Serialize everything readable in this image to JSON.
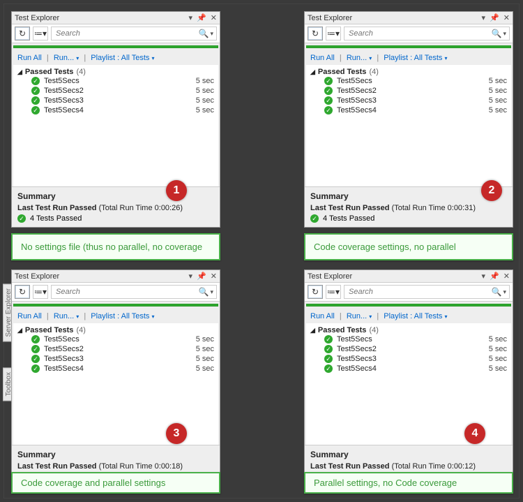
{
  "panels": [
    {
      "caption": "No settings file (thus no parallel, no coverage",
      "badge": "1",
      "run_time": "(Total Run Time 0:00:26)"
    },
    {
      "caption": "Code coverage settings, no parallel",
      "badge": "2",
      "run_time": "(Total Run Time 0:00:31)"
    },
    {
      "caption": "Code coverage and parallel settings",
      "badge": "3",
      "run_time": "(Total Run Time 0:00:18)"
    },
    {
      "caption": "Parallel settings, no Code coverage",
      "badge": "4",
      "run_time": "(Total Run Time 0:00:12)"
    }
  ],
  "common": {
    "title": "Test Explorer",
    "search_placeholder": "Search",
    "link_run_all": "Run All",
    "link_run": "Run...",
    "link_playlist": "Playlist : All Tests",
    "group_label": "Passed Tests",
    "group_count": "(4)",
    "tests": [
      {
        "name": "Test5Secs",
        "dur": "5 sec"
      },
      {
        "name": "Test5Secs2",
        "dur": "5 sec"
      },
      {
        "name": "Test5Secs3",
        "dur": "5 sec"
      },
      {
        "name": "Test5Secs4",
        "dur": "5 sec"
      }
    ],
    "summary_title": "Summary",
    "last_run_label": "Last Test Run Passed",
    "passed_count_text": "4 Tests Passed",
    "sidetab1": "Server Explorer",
    "sidetab2": "Toolbox"
  }
}
